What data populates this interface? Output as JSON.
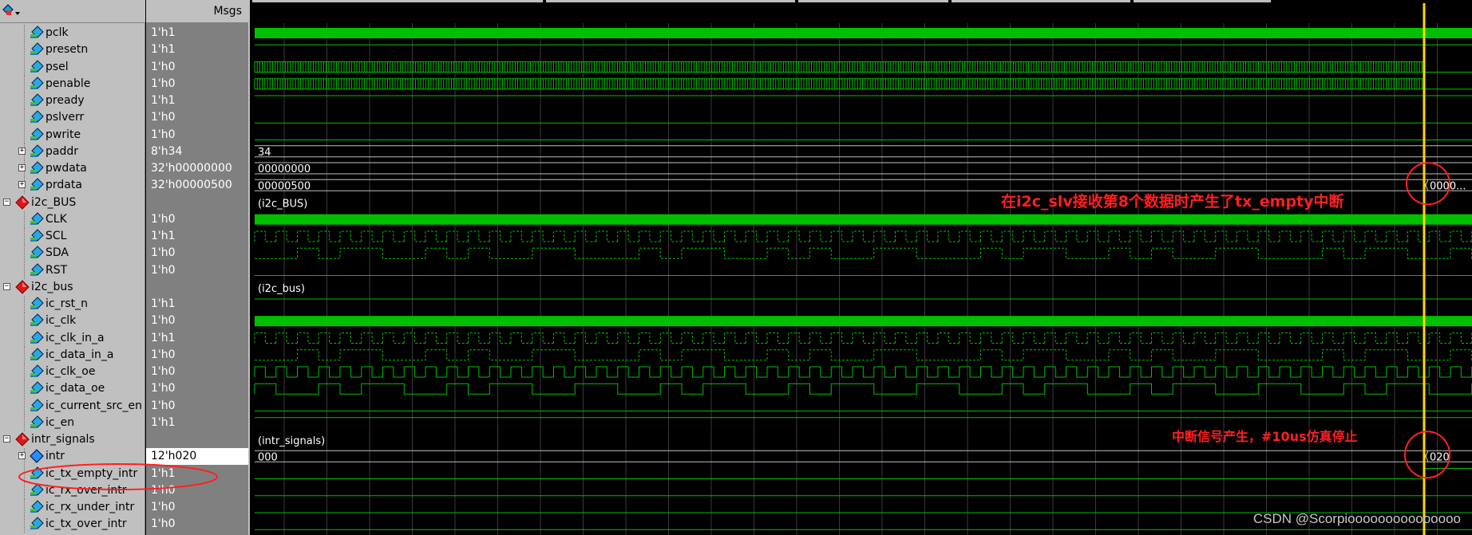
{
  "header": {
    "msgs_label": "Msgs"
  },
  "signals": [
    {
      "name": "pclk",
      "value": "1'h1",
      "level": 1,
      "kind": "leaf",
      "icon": "cyan-signal-icon"
    },
    {
      "name": "presetn",
      "value": "1'h1",
      "level": 1,
      "kind": "leaf",
      "icon": "cyan-signal-icon"
    },
    {
      "name": "psel",
      "value": "1'h0",
      "level": 1,
      "kind": "leaf",
      "icon": "cyan-signal-icon"
    },
    {
      "name": "penable",
      "value": "1'h0",
      "level": 1,
      "kind": "leaf",
      "icon": "cyan-signal-icon"
    },
    {
      "name": "pready",
      "value": "1'h1",
      "level": 1,
      "kind": "leaf",
      "icon": "cyan-signal-icon"
    },
    {
      "name": "pslverr",
      "value": "1'h0",
      "level": 1,
      "kind": "leaf",
      "icon": "cyan-signal-icon"
    },
    {
      "name": "pwrite",
      "value": "1'h0",
      "level": 1,
      "kind": "leaf",
      "icon": "cyan-signal-icon"
    },
    {
      "name": "paddr",
      "value": "8'h34",
      "level": 1,
      "kind": "bus",
      "icon": "cyan-signal-icon"
    },
    {
      "name": "pwdata",
      "value": "32'h00000000",
      "level": 1,
      "kind": "bus",
      "icon": "cyan-signal-icon"
    },
    {
      "name": "prdata",
      "value": "32'h00000500",
      "level": 1,
      "kind": "bus",
      "icon": "cyan-signal-icon"
    },
    {
      "name": "i2c_BUS",
      "value": "",
      "level": 0,
      "kind": "group",
      "icon": "red-diamond-icon"
    },
    {
      "name": "CLK",
      "value": "1'h0",
      "level": 1,
      "kind": "leaf",
      "icon": "cyan-signal-icon"
    },
    {
      "name": "SCL",
      "value": "1'h1",
      "level": 1,
      "kind": "leaf",
      "icon": "cyan-signal-icon"
    },
    {
      "name": "SDA",
      "value": "1'h0",
      "level": 1,
      "kind": "leaf",
      "icon": "cyan-signal-icon"
    },
    {
      "name": "RST",
      "value": "1'h0",
      "level": 1,
      "kind": "leaf",
      "icon": "cyan-signal-icon"
    },
    {
      "name": "i2c_bus",
      "value": "",
      "level": 0,
      "kind": "group",
      "icon": "red-diamond-icon"
    },
    {
      "name": "ic_rst_n",
      "value": "1'h1",
      "level": 1,
      "kind": "leaf",
      "icon": "cyan-signal-icon"
    },
    {
      "name": "ic_clk",
      "value": "1'h0",
      "level": 1,
      "kind": "leaf",
      "icon": "cyan-signal-icon"
    },
    {
      "name": "ic_clk_in_a",
      "value": "1'h1",
      "level": 1,
      "kind": "leaf",
      "icon": "cyan-signal-icon"
    },
    {
      "name": "ic_data_in_a",
      "value": "1'h0",
      "level": 1,
      "kind": "leaf",
      "icon": "cyan-signal-icon"
    },
    {
      "name": "ic_clk_oe",
      "value": "1'h0",
      "level": 1,
      "kind": "leaf",
      "icon": "cyan-signal-icon"
    },
    {
      "name": "ic_data_oe",
      "value": "1'h0",
      "level": 1,
      "kind": "leaf",
      "icon": "cyan-signal-icon"
    },
    {
      "name": "ic_current_src_en",
      "value": "1'h0",
      "level": 1,
      "kind": "leaf",
      "icon": "cyan-signal-icon"
    },
    {
      "name": "ic_en",
      "value": "1'h1",
      "level": 1,
      "kind": "leaf",
      "icon": "cyan-signal-icon"
    },
    {
      "name": "intr_signals",
      "value": "",
      "level": 0,
      "kind": "group",
      "icon": "red-diamond-icon"
    },
    {
      "name": "intr",
      "value": "12'h020",
      "level": 1,
      "kind": "bus",
      "icon": "blue-diamond-icon",
      "selected": true
    },
    {
      "name": "ic_tx_empty_intr",
      "value": "1'h1",
      "level": 1,
      "kind": "leaf",
      "icon": "cyan-signal-icon"
    },
    {
      "name": "ic_rx_over_intr",
      "value": "1'h0",
      "level": 1,
      "kind": "leaf",
      "icon": "cyan-signal-icon"
    },
    {
      "name": "ic_rx_under_intr",
      "value": "1'h0",
      "level": 1,
      "kind": "leaf",
      "icon": "cyan-signal-icon"
    },
    {
      "name": "ic_tx_over_intr",
      "value": "1'h0",
      "level": 1,
      "kind": "leaf",
      "icon": "cyan-signal-icon"
    }
  ],
  "wave_labels": {
    "paddr": "34",
    "pwdata": "00000000",
    "prdata_left": "00000500",
    "prdata_right": "0000...",
    "group_i2c_BUS": "(i2c_BUS)",
    "group_i2c_bus": "(i2c_bus)",
    "group_intr_signals": "(intr_signals)",
    "intr_left": "000",
    "intr_right": "020"
  },
  "annotations": {
    "tx_empty_note": "在i2c_slv接收第8个数据时产生了tx_empty中断",
    "stop_note": "中断信号产生，#10us仿真停止"
  },
  "watermark": "CSDN @Scorpiooooooooooooooo",
  "colors": {
    "wave_green": "#00c000",
    "cursor_yellow": "#ffd700",
    "annotation_red": "#ff2020",
    "grid": "#303030"
  }
}
